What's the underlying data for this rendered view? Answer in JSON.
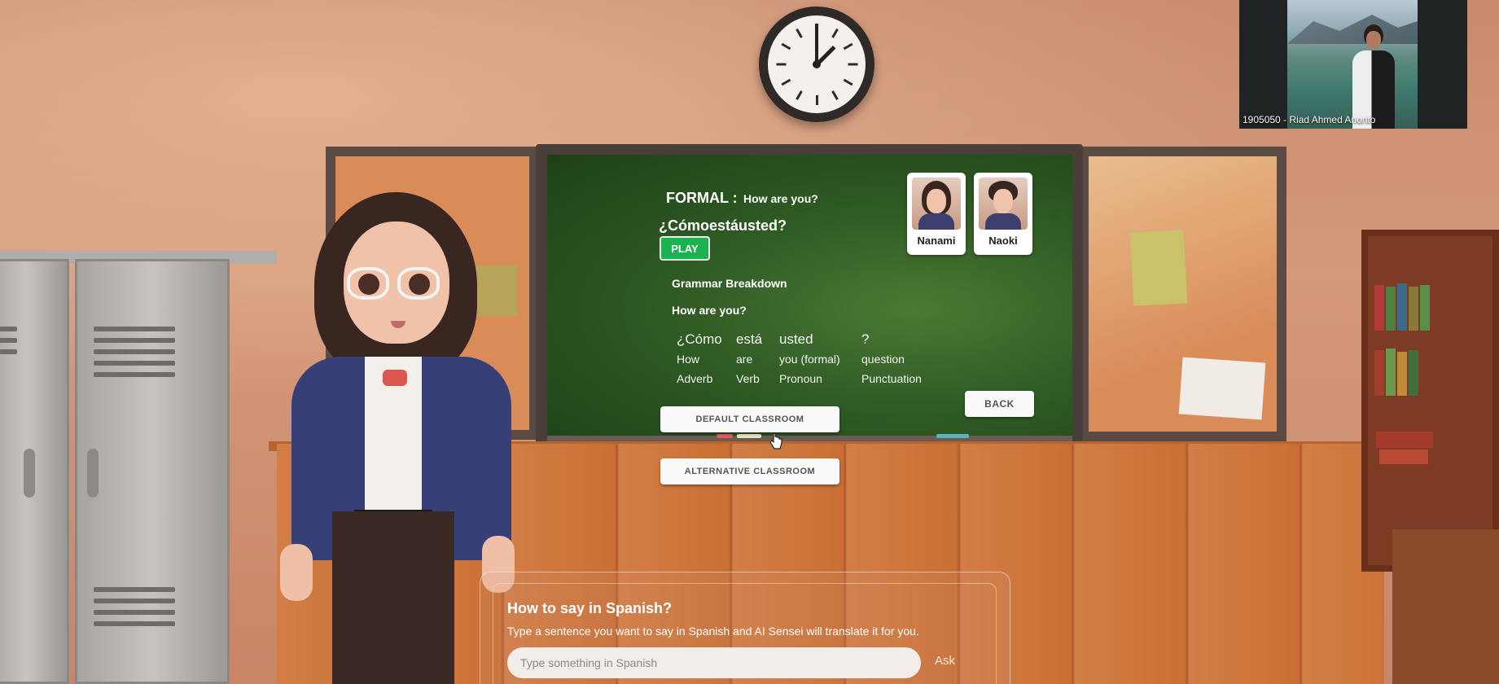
{
  "webcam": {
    "caption": "1905050 - Riad Ahmed Anonto"
  },
  "lesson": {
    "formal_label": "FORMAL :",
    "english": "How are you?",
    "spanish": "¿Cómoestáusted?",
    "play_label": "PLAY",
    "breakdown_title": "Grammar Breakdown",
    "breakdown_sentence": "How are you?",
    "breakdown": [
      {
        "word": "¿Cómo",
        "meaning": "How",
        "part": "Adverb"
      },
      {
        "word": "está",
        "meaning": "are",
        "part": "Verb"
      },
      {
        "word": "usted",
        "meaning": "you (formal)",
        "part": "Pronoun"
      },
      {
        "word": "?",
        "meaning": "question",
        "part": "Punctuation"
      }
    ]
  },
  "characters": [
    {
      "name": "Nanami"
    },
    {
      "name": "Naoki"
    }
  ],
  "buttons": {
    "back": "BACK",
    "default_classroom": "DEFAULT CLASSROOM",
    "alternative_classroom": "ALTERNATIVE CLASSROOM"
  },
  "translator": {
    "title": "How to say in Spanish?",
    "description": "Type a sentence you want to say in Spanish and AI Sensei will translate it for you.",
    "placeholder": "Type something in Spanish",
    "ask_label": "Ask"
  },
  "colors": {
    "play_green": "#1bb34f",
    "board_green": "#2f5b24",
    "wall": "#c78a6e"
  }
}
